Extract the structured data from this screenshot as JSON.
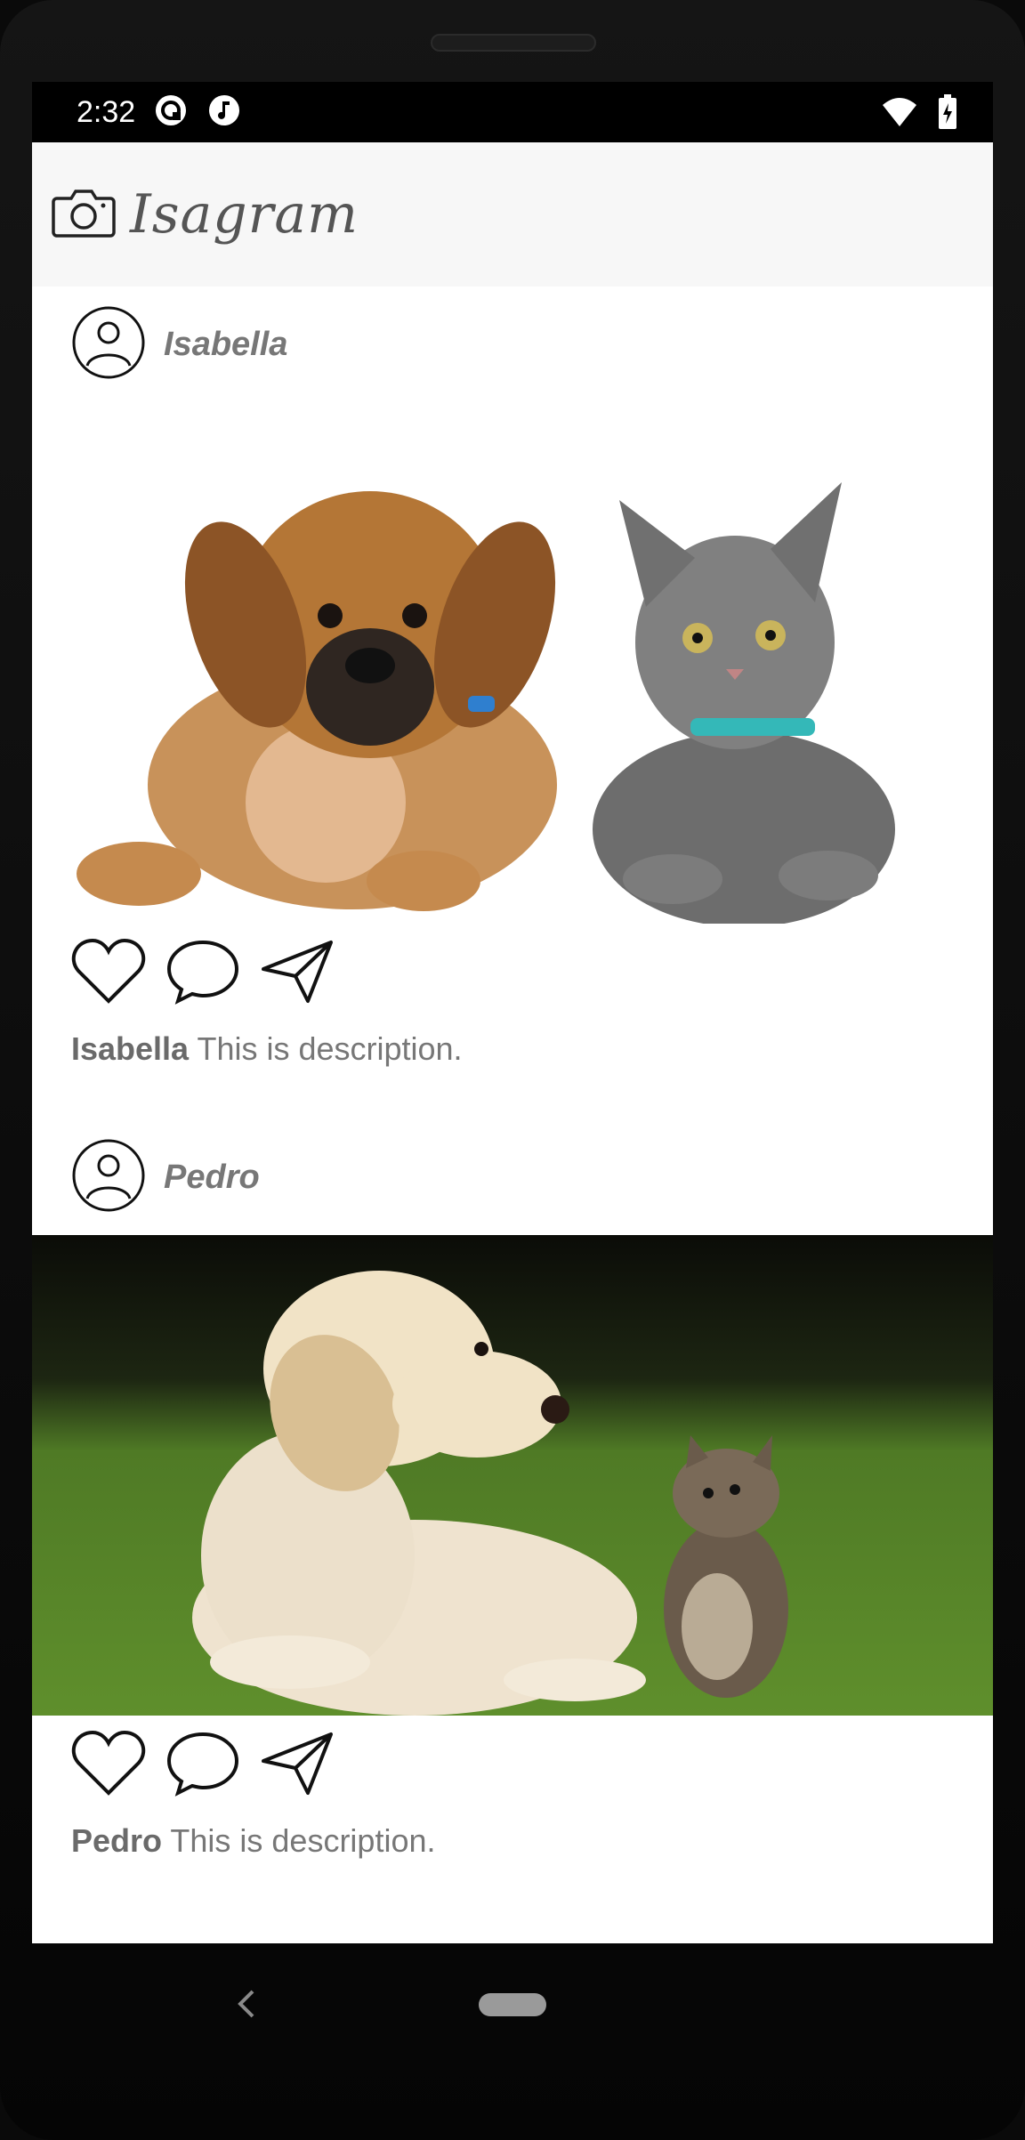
{
  "status_bar": {
    "time": "2:32",
    "left_icons": [
      "sync-icon",
      "music-note-icon"
    ],
    "right_icons": [
      "wifi-icon",
      "battery-charging-icon"
    ]
  },
  "app_bar": {
    "logo_icon": "camera-icon",
    "title": "Isagram"
  },
  "posts": [
    {
      "username": "Isabella",
      "avatar_icon": "user-avatar-icon",
      "image": "puppy-and-gray-kitten-photo",
      "actions": [
        "heart-icon",
        "comment-icon",
        "send-icon"
      ],
      "caption_user": "Isabella",
      "caption_text": "This is description."
    },
    {
      "username": "Pedro",
      "avatar_icon": "user-avatar-icon",
      "image": "golden-puppy-and-kitten-on-grass-photo",
      "actions": [
        "heart-icon",
        "comment-icon",
        "send-icon"
      ],
      "caption_user": "Pedro",
      "caption_text": "This is description."
    }
  ],
  "nav_bar": {
    "back_icon": "back-chevron-icon",
    "home_icon": "home-pill-icon"
  },
  "colors": {
    "app_bar_bg": "#f7f7f7",
    "text_gray": "#777777",
    "device_frame": "#0a0a0a"
  }
}
